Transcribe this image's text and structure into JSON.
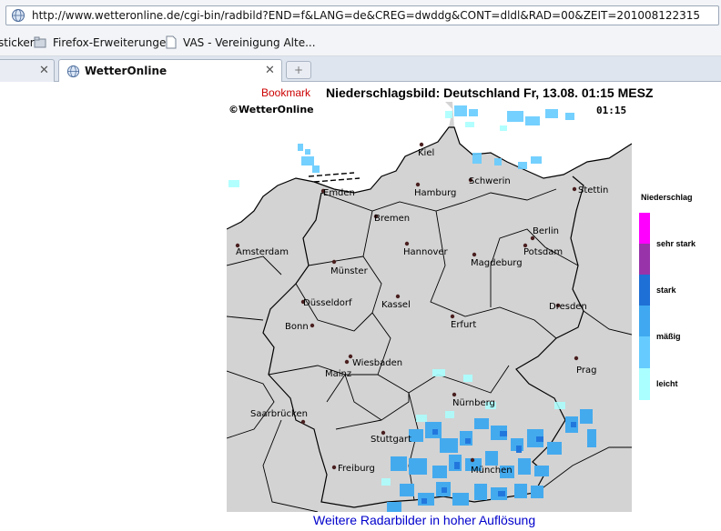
{
  "browser": {
    "url": "http://www.wetteronline.de/cgi-bin/radbild?END=f&LANG=de&CREG=dwddg&CONT=dldl&RAD=00&ZEIT=201008122315",
    "bookmarks": [
      {
        "label": "sticker"
      },
      {
        "label": "Firefox-Erweiterungen"
      },
      {
        "label": "VAS - Vereinigung Alte..."
      }
    ],
    "tabs": [
      {
        "label": ""
      },
      {
        "label": "WetterOnline"
      }
    ],
    "new_tab_label": "+"
  },
  "page": {
    "bookmark_link": "Bookmark",
    "title": "Niederschlagsbild: Deutschland Fr, 13.08. 01:15 MESZ",
    "copyright": "©WetterOnline",
    "time": "01:15",
    "footer_link": "Weitere Radarbilder in hoher Auflösung"
  },
  "map": {
    "cities": [
      "Kiel",
      "Emden",
      "Hamburg",
      "Schwerin",
      "Stettin",
      "Bremen",
      "Berlin",
      "Potsdam",
      "Amsterdam",
      "Hannover",
      "Magdeburg",
      "Münster",
      "Düsseldorf",
      "Kassel",
      "Dresden",
      "Bonn",
      "Erfurt",
      "Wiesbaden",
      "Mainz",
      "Prag",
      "Nürnberg",
      "Saarbrücken",
      "Stuttgart",
      "Freiburg",
      "München"
    ]
  },
  "legend": {
    "title": "Niederschlag",
    "levels": [
      {
        "label": "sehr stark",
        "color": "#ff00ff"
      },
      {
        "label": "stark",
        "color": "#2277dd"
      },
      {
        "label": "mäßig",
        "color": "#44bbff"
      },
      {
        "label": "leicht",
        "color": "#aaffff"
      }
    ],
    "colors": [
      "#ff00ff",
      "#9933aa",
      "#1e6fd6",
      "#3fa8f0",
      "#66ccff",
      "#aaffff"
    ]
  }
}
